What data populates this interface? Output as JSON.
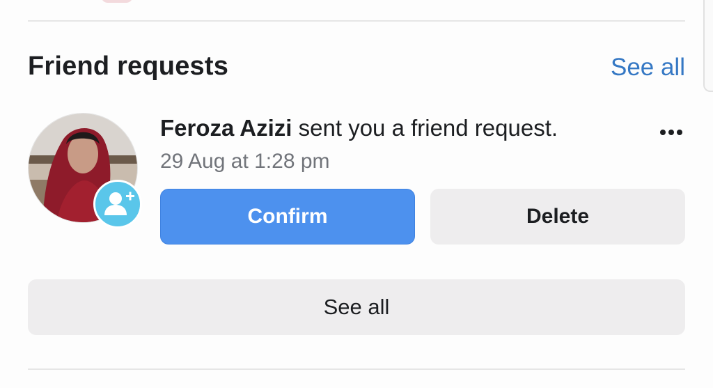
{
  "section": {
    "title": "Friend requests",
    "see_all_link": "See all"
  },
  "request": {
    "name": "Feroza Azizi",
    "message": " sent you a friend request.",
    "timestamp": "29 Aug at 1:28 pm",
    "confirm_label": "Confirm",
    "delete_label": "Delete"
  },
  "footer": {
    "see_all_label": "See all"
  },
  "icons": {
    "more": "more-options-icon",
    "badge": "add-friend-icon"
  },
  "colors": {
    "primary": "#4d91ee",
    "link": "#3578c4",
    "badge": "#5ac6ea",
    "secondary_button": "#eeedee"
  }
}
